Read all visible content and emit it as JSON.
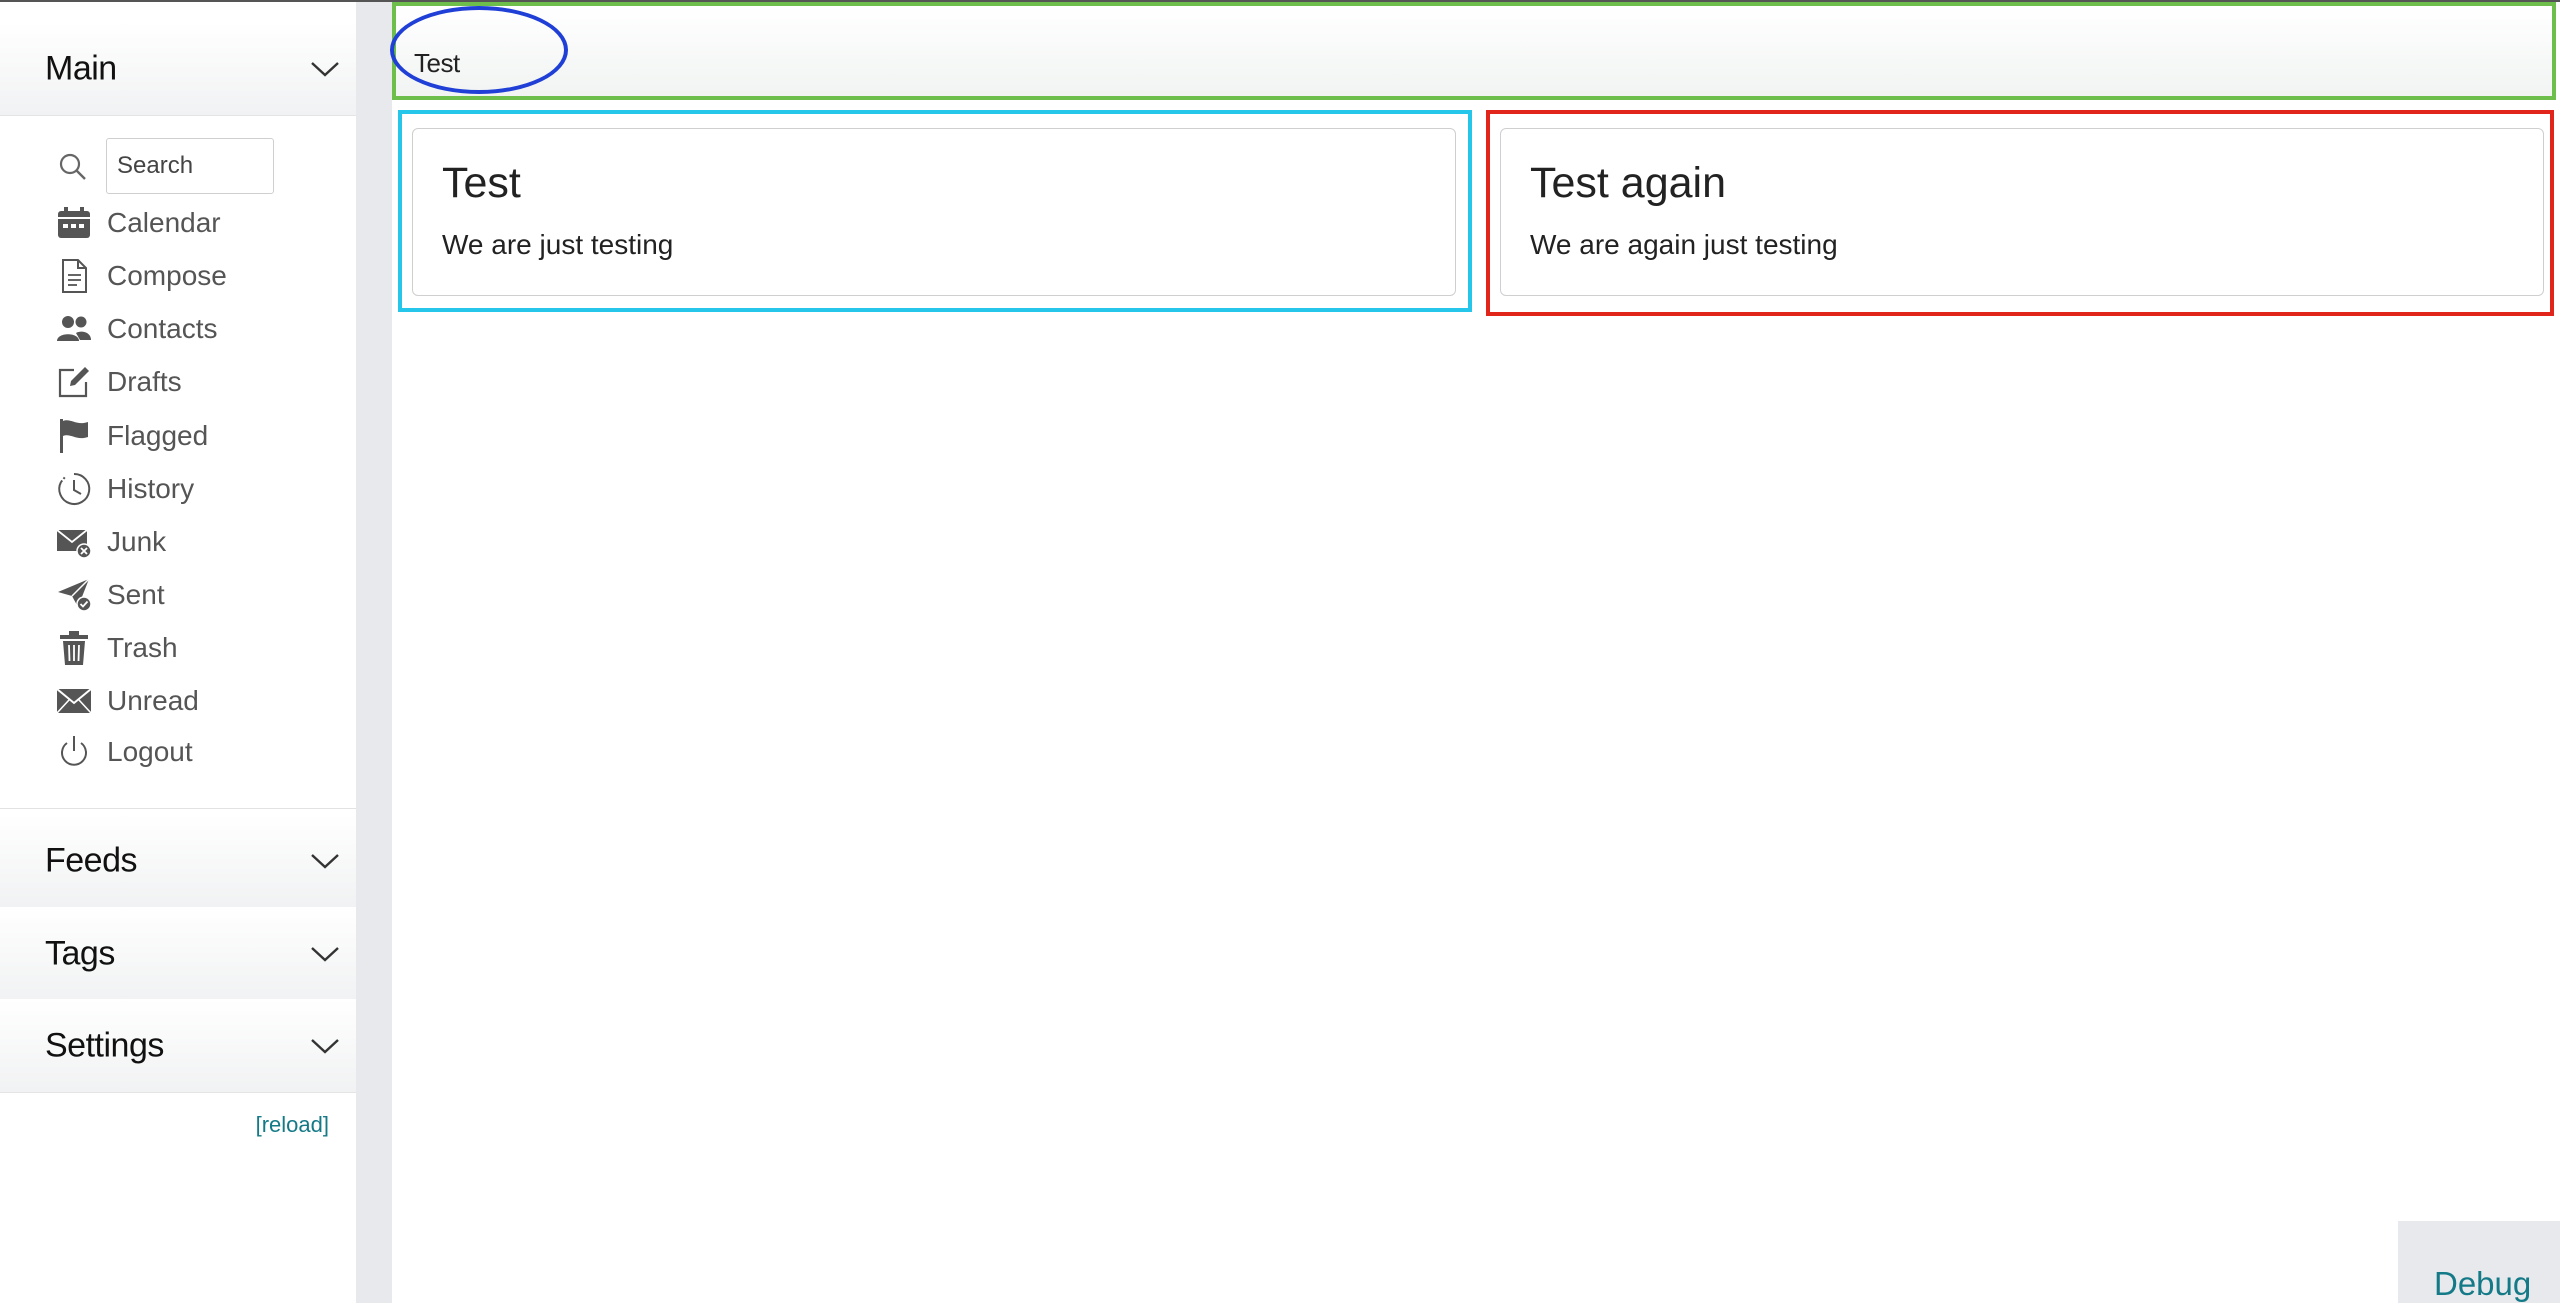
{
  "sidebar": {
    "sections": {
      "main": "Main",
      "feeds": "Feeds",
      "tags": "Tags",
      "settings": "Settings"
    },
    "search": {
      "placeholder": "Search",
      "value": ""
    },
    "items": [
      {
        "label": "Calendar",
        "icon": "calendar-icon"
      },
      {
        "label": "Compose",
        "icon": "document-icon"
      },
      {
        "label": "Contacts",
        "icon": "people-icon"
      },
      {
        "label": "Drafts",
        "icon": "pencil-square-icon"
      },
      {
        "label": "Flagged",
        "icon": "flag-icon"
      },
      {
        "label": "History",
        "icon": "clock-icon"
      },
      {
        "label": "Junk",
        "icon": "envelope-x-icon"
      },
      {
        "label": "Sent",
        "icon": "send-check-icon"
      },
      {
        "label": "Trash",
        "icon": "trash-icon"
      },
      {
        "label": "Unread",
        "icon": "envelope-icon"
      },
      {
        "label": "Logout",
        "icon": "power-icon"
      }
    ],
    "reload": "[reload]"
  },
  "header": {
    "title": "Test"
  },
  "cards": [
    {
      "title": "Test",
      "text": "We are just testing"
    },
    {
      "title": "Test again",
      "text": "We are again just testing"
    }
  ],
  "debug": "Debug",
  "colors": {
    "accent_link": "#147a87",
    "header_border": "#6ebe4b",
    "oval": "#1f3fd6",
    "card_left_border": "#25c6ea",
    "card_right_border": "#e1251b"
  }
}
